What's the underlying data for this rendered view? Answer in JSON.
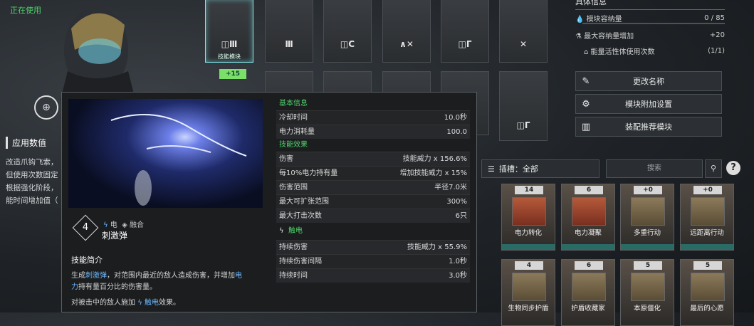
{
  "status": "正在使用",
  "apply": {
    "header": "应用数值",
    "lines": [
      "改造爪钩飞索，",
      "但使用次数固定",
      "根据强化阶段，",
      "能时间增加值（"
    ]
  },
  "module_grid": {
    "slot1_caption": "技能模块",
    "slot1_badge": "+15",
    "glyphs": [
      "◫Ⅲ",
      "Ⅲ",
      "◫C",
      "∧✕",
      "◫Γ",
      "✕",
      "",
      "",
      "",
      "",
      "",
      "◫Γ"
    ]
  },
  "info": {
    "title": "具体信息",
    "capacity_label": "模块容纳量",
    "capacity_value": "0 / 85",
    "max_cap_label": "最大容纳量增加",
    "max_cap_value": "+20",
    "energy_label": "能量活性体使用次数",
    "energy_value": "(1/1)"
  },
  "buttons": {
    "rename": "更改名称",
    "extra_settings": "模块附加设置",
    "recommend": "装配推荐模块"
  },
  "filter": {
    "label": "插槽：全部",
    "search_placeholder": "搜索"
  },
  "cards": [
    {
      "cost": "14",
      "name": "电力转化"
    },
    {
      "cost": "6",
      "name": "电力凝聚"
    },
    {
      "cost": "+0",
      "name": "多重行动"
    },
    {
      "cost": "+0",
      "name": "远距离行动"
    },
    {
      "cost": "4",
      "name": "生物同步护盾"
    },
    {
      "cost": "6",
      "name": "护盾收藏家"
    },
    {
      "cost": "5",
      "name": "本原僵化"
    },
    {
      "cost": "5",
      "name": "最后的心愿"
    }
  ],
  "tooltip": {
    "skill_num": "4",
    "tag_electric": "电",
    "tag_fusion": "融合",
    "skill_name": "刺激弹",
    "intro_header": "技能简介",
    "intro_1a": "生成",
    "intro_1b": "刺激弹",
    "intro_1c": "，对范围内最近的敌人造成伤害，并增加",
    "intro_1d": "电",
    "intro_2a": "力",
    "intro_2b": "持有量百分比的伤害量。",
    "intro_3a": "对被击中的敌人施加",
    "intro_3b": "触电",
    "intro_3c": "效果。",
    "basic_header": "基本信息",
    "effect_header": "技能效果",
    "shock_header": "触电",
    "basic": [
      {
        "k": "冷却时间",
        "v": "10.0秒"
      },
      {
        "k": "电力消耗量",
        "v": "100.0"
      }
    ],
    "effects": [
      {
        "k": "伤害",
        "v": "技能威力 x 156.6%"
      },
      {
        "k": "每10%电力持有量",
        "v": "增加技能威力 x 15%"
      },
      {
        "k": "伤害范围",
        "v": "半径7.0米"
      },
      {
        "k": "最大可扩张范围",
        "v": "300%"
      },
      {
        "k": "最大打击次数",
        "v": "6只"
      }
    ],
    "shock": [
      {
        "k": "持续伤害",
        "v": "技能威力 x 55.9%"
      },
      {
        "k": "持续伤害间隔",
        "v": "1.0秒"
      },
      {
        "k": "持续时间",
        "v": "3.0秒"
      }
    ]
  }
}
